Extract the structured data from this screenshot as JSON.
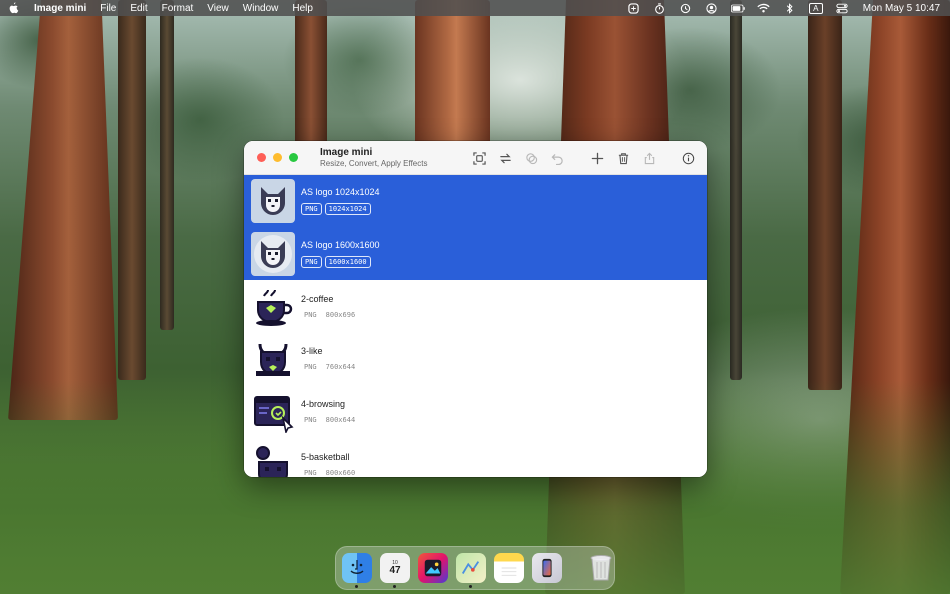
{
  "menubar": {
    "app_name": "Image mini",
    "menus": [
      "File",
      "Edit",
      "Format",
      "View",
      "Window",
      "Help"
    ],
    "input_indicator": "A",
    "clock": "Mon May 5  10:47"
  },
  "window": {
    "title": "Image mini",
    "subtitle": "Resize, Convert, Apply Effects",
    "files": [
      {
        "name": "AS logo 1024x1024",
        "format": "PNG",
        "size": "1024x1024",
        "selected": true
      },
      {
        "name": "AS logo 1600x1600",
        "format": "PNG",
        "size": "1600x1600",
        "selected": true
      },
      {
        "name": "2-coffee",
        "format": "PNG",
        "size": "800x696",
        "selected": false
      },
      {
        "name": "3-like",
        "format": "PNG",
        "size": "760x644",
        "selected": false
      },
      {
        "name": "4-browsing",
        "format": "PNG",
        "size": "800x644",
        "selected": false
      },
      {
        "name": "5-basketball",
        "format": "PNG",
        "size": "800x660",
        "selected": false
      }
    ]
  },
  "dock": {
    "calendar": {
      "month": "10",
      "day": "47"
    }
  },
  "colors": {
    "selection": "#2a5fd9",
    "close": "#fe5f57",
    "minimize": "#febc2e",
    "maximize": "#28c840"
  }
}
